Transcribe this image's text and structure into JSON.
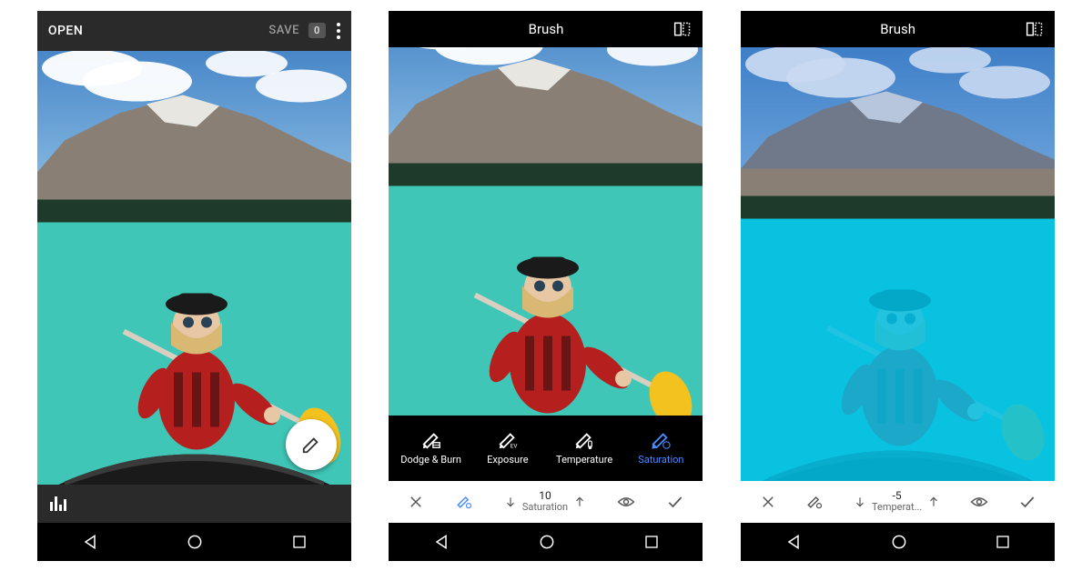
{
  "screen1": {
    "open_label": "OPEN",
    "save_label": "SAVE",
    "history_badge": "0"
  },
  "screen2": {
    "title": "Brush",
    "brush_options": {
      "dodge": "Dodge & Burn",
      "exposure": "Exposure",
      "temperature": "Temperature",
      "saturation": "Saturation"
    },
    "value": "10",
    "value_label": "Saturation"
  },
  "screen3": {
    "title": "Brush",
    "value": "-5",
    "value_label": "Temperat..."
  },
  "colors": {
    "active_blue": "#4a8cff"
  }
}
